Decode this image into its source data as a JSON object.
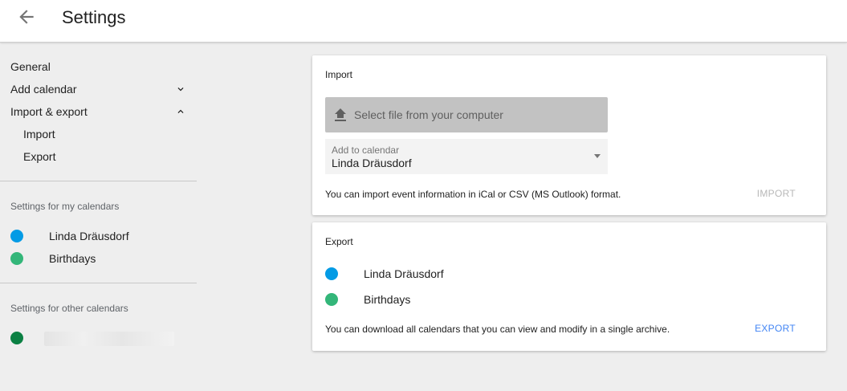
{
  "header": {
    "title": "Settings",
    "back_icon": "arrow-back-icon"
  },
  "sidebar": {
    "items": [
      {
        "label": "General"
      },
      {
        "label": "Add calendar",
        "icon": "chevron-down-icon"
      },
      {
        "label": "Import & export",
        "icon": "chevron-up-icon"
      },
      {
        "label": "Import"
      },
      {
        "label": "Export"
      }
    ],
    "my_calendars_label": "Settings for my calendars",
    "my_calendars": [
      {
        "name": "Linda Dräusdorf",
        "color": "#039be5"
      },
      {
        "name": "Birthdays",
        "color": "#33b679"
      }
    ],
    "other_calendars_label": "Settings for other calendars",
    "other_calendars": [
      {
        "name": "",
        "color": "#0b8043"
      }
    ]
  },
  "import_card": {
    "title": "Import",
    "file_button_label": "Select file from your computer",
    "file_button_icon": "upload-icon",
    "select_label": "Add to calendar",
    "select_value": "Linda Dräusdorf",
    "note": "You can import event information in iCal or CSV (MS Outlook) format.",
    "action": "IMPORT"
  },
  "export_card": {
    "title": "Export",
    "calendars": [
      {
        "name": "Linda Dräusdorf",
        "color": "#039be5"
      },
      {
        "name": "Birthdays",
        "color": "#33b679"
      }
    ],
    "note": "You can download all calendars that you can view and modify in a single archive.",
    "action": "EXPORT"
  },
  "colors": {
    "accent": "#4285f4",
    "background": "#eeeeee"
  }
}
